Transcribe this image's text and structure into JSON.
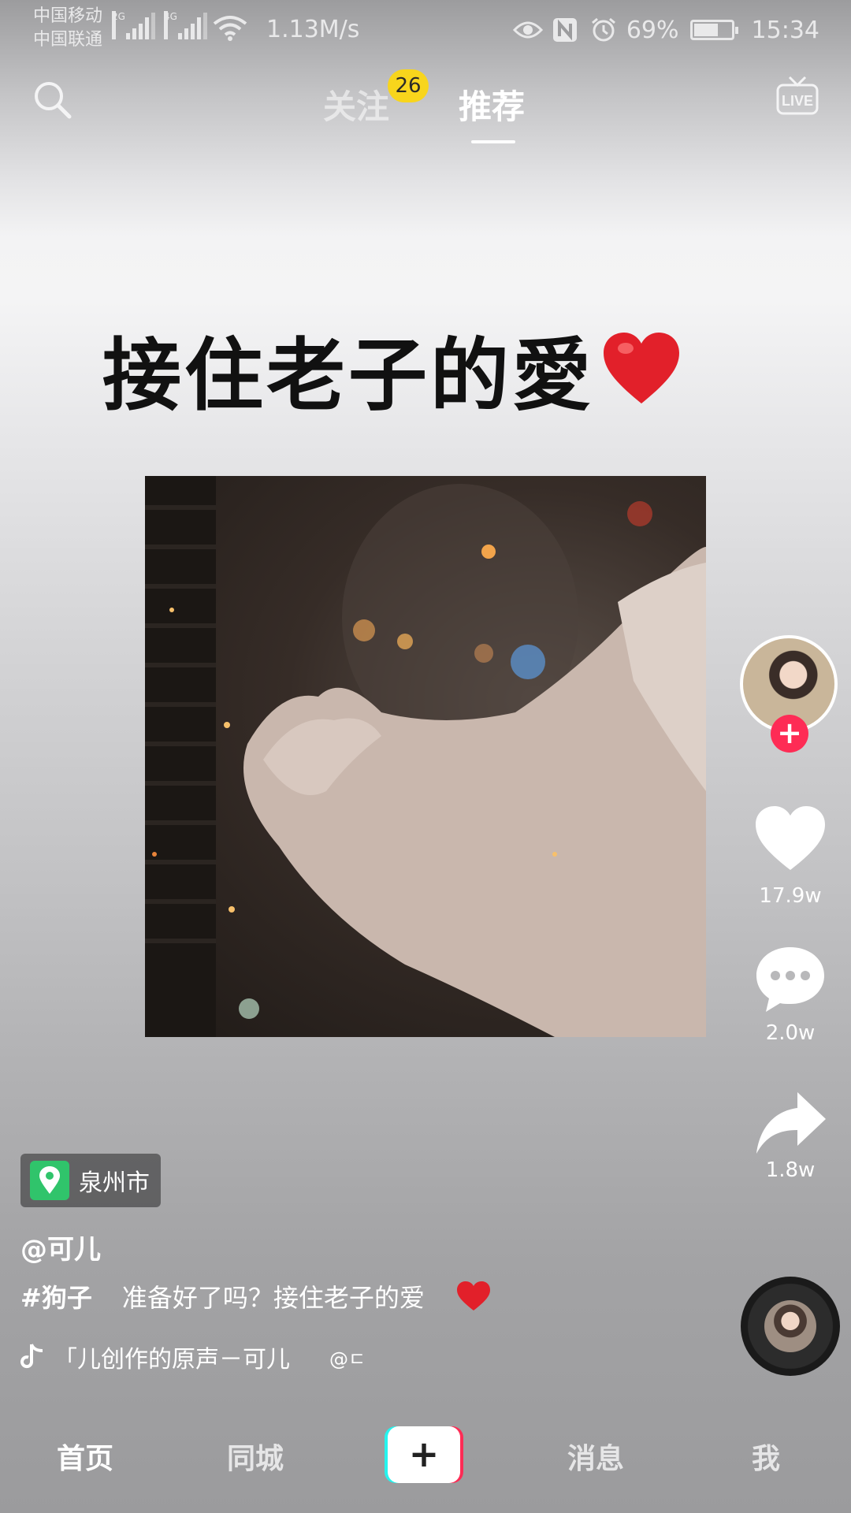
{
  "status_bar": {
    "carrier_1": "中国移动",
    "carrier_2": "中国联通",
    "signal_1_type": "2G",
    "signal_2_type": "4G",
    "net_speed": "1.13M/s",
    "battery": "69%",
    "battery_level": 0.69,
    "time": "15:34",
    "icons": [
      "signal-icon",
      "wifi-icon",
      "eye-icon",
      "nfc-icon",
      "alarm-icon",
      "battery-icon"
    ]
  },
  "top_nav": {
    "follow_tab": "关注",
    "follow_badge": "26",
    "recommend_tab": "推荐",
    "active_tab": "推荐",
    "left_icon": "search-icon",
    "right_icon": "live-icon",
    "live_label": "LIVE"
  },
  "video": {
    "caption": "接住老子的愛",
    "caption_emoji": "heart-emoji",
    "subject": "cat"
  },
  "actions": {
    "like_count": "17.9w",
    "comment_count": "2.0w",
    "share_count": "1.8w",
    "follow_plus": "+"
  },
  "post": {
    "location": "泉州市",
    "username": "@可儿",
    "hashtag": "#狗子",
    "description": "准备好了吗？接住老子的爱",
    "music": "「儿创作的原声－可儿",
    "music_mention": "@ㄷ"
  },
  "bottom_nav": {
    "home": "首页",
    "local": "同城",
    "create": "+",
    "messages": "消息",
    "me": "我"
  },
  "colors": {
    "accent_red": "#fe2c55",
    "accent_cyan": "#25f4ee",
    "badge_yellow": "#f8d51c",
    "location_green": "#30c46b"
  }
}
